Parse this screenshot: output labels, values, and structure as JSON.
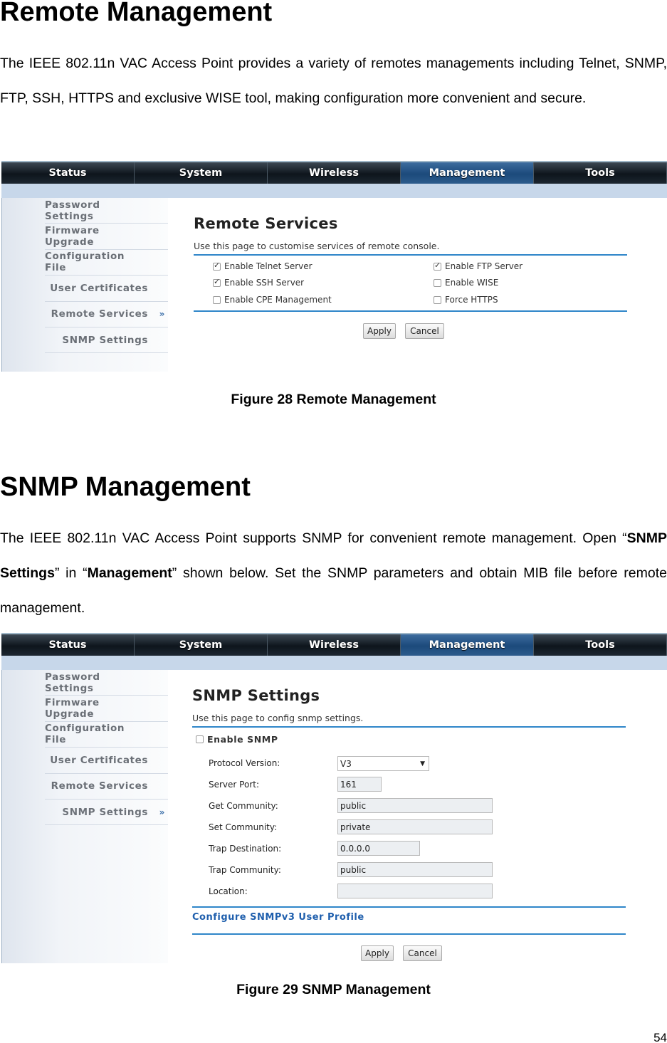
{
  "section1": {
    "heading": "Remote Management",
    "paragraph": "The IEEE 802.11n VAC Access Point provides a variety of remotes managements including Telnet, SNMP, FTP, SSH, HTTPS and exclusive WISE tool, making configuration more convenient and secure.",
    "caption": "Figure 28 Remote Management"
  },
  "section2": {
    "heading": "SNMP Management",
    "para_part1": "The IEEE 802.11n VAC Access Point supports SNMP for convenient remote management. Open “",
    "para_bold1": "SNMP Settings",
    "para_part2": "” in “",
    "para_bold2": "Management",
    "para_part3": "” shown below. Set the SNMP parameters and obtain MIB file before remote management.",
    "caption": "Figure 29 SNMP Management"
  },
  "nav": {
    "tabs": [
      "Status",
      "System",
      "Wireless",
      "Management",
      "Tools"
    ],
    "active": "Management"
  },
  "sidebar": {
    "items": [
      "Password Settings",
      "Firmware Upgrade",
      "Configuration File",
      "User Certificates",
      "Remote Services",
      "SNMP Settings"
    ],
    "active_marker": "»"
  },
  "remote_services": {
    "title": "Remote Services",
    "description": "Use this page to customise services of remote console.",
    "options": [
      {
        "label": "Enable Telnet Server",
        "checked": true
      },
      {
        "label": "Enable FTP Server",
        "checked": true
      },
      {
        "label": "Enable SSH Server",
        "checked": true
      },
      {
        "label": "Enable WISE",
        "checked": false
      },
      {
        "label": "Enable CPE Management",
        "checked": false
      },
      {
        "label": "Force HTTPS",
        "checked": false
      }
    ],
    "apply_label": "Apply",
    "cancel_label": "Cancel"
  },
  "snmp_settings": {
    "title": "SNMP Settings",
    "description": "Use this page to config snmp settings.",
    "enable_label": "Enable SNMP",
    "enable_checked": false,
    "fields": [
      {
        "label": "Protocol Version:",
        "value": "V3"
      },
      {
        "label": "Server Port:",
        "value": "161"
      },
      {
        "label": "Get Community:",
        "value": "public"
      },
      {
        "label": "Set Community:",
        "value": "private"
      },
      {
        "label": "Trap Destination:",
        "value": "0.0.0.0"
      },
      {
        "label": "Trap Community:",
        "value": "public"
      },
      {
        "label": "Location:",
        "value": ""
      }
    ],
    "v3_link": "Configure SNMPv3 User Profile",
    "apply_label": "Apply",
    "cancel_label": "Cancel"
  },
  "page_number": "54"
}
